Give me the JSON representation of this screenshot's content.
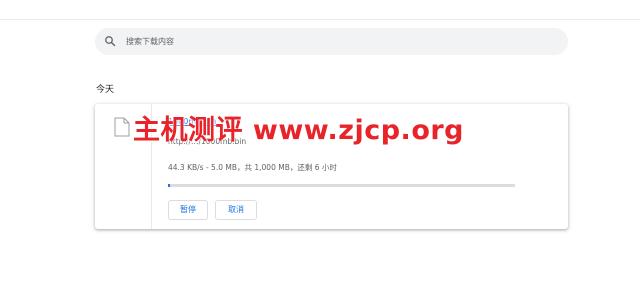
{
  "search": {
    "placeholder": "搜索下载内容"
  },
  "date_group": {
    "label": "今天"
  },
  "download": {
    "file_name": "1000mb.bin",
    "url": "http://…/1000mb.bin",
    "status": "44.3 KB/s - 5.0 MB，共 1,000 MB，还剩 6 小时",
    "progress_fraction": 0.005,
    "pause_label": "暂停",
    "cancel_label": "取消"
  },
  "watermark": {
    "text": "主机测评 www.zjcp.org"
  },
  "colors": {
    "accent": "#1a73e8",
    "search_bg": "#f1f3f4",
    "watermark": "#e8232a"
  }
}
